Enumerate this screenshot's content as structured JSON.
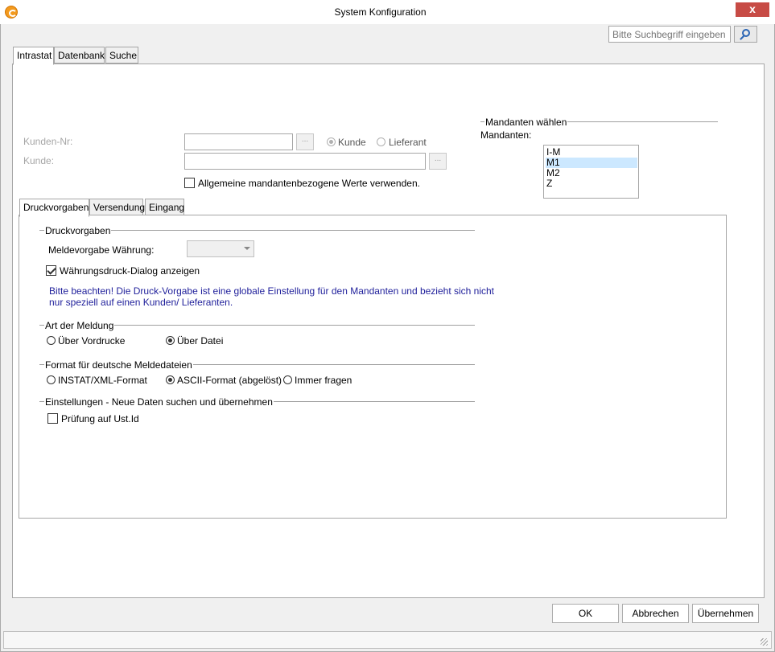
{
  "window": {
    "title": "System Konfiguration",
    "close_label": "x"
  },
  "search": {
    "placeholder": "Bitte Suchbegriff eingeben"
  },
  "main_tabs": [
    "Intrastat",
    "Datenbank",
    "Suche"
  ],
  "customer": {
    "kunden_nr_label": "Kunden-Nr:",
    "kunde_label": "Kunde:",
    "browse_label": "...",
    "radio_kunde": "Kunde",
    "radio_lieferant": "Lieferant",
    "general_values_label": "Allgemeine mandantenbezogene Werte verwenden."
  },
  "mandanten": {
    "group_title": "Mandanten wählen",
    "label": "Mandanten:",
    "items": [
      "I-M",
      "M1",
      "M2",
      "Z"
    ],
    "selected": "M1"
  },
  "sub_tabs": [
    "Druckvorgaben",
    "Versendung",
    "Eingang"
  ],
  "druckvorgaben": {
    "group_title": "Druckvorgaben",
    "meldevorgabe_label": "Meldevorgabe Währung:",
    "currency_dialog_label": "Währungsdruck-Dialog anzeigen",
    "note_line1": "Bitte beachten! Die Druck-Vorgabe ist eine globale Einstellung für den Mandanten und bezieht sich nicht",
    "note_line2": "nur speziell auf einen Kunden/ Lieferanten."
  },
  "art_der_meldung": {
    "group_title": "Art der Meldung",
    "option1": "Über Vordrucke",
    "option2": "Über Datei"
  },
  "format": {
    "group_title": "Format für deutsche Meldedateien",
    "option1": "INSTAT/XML-Format",
    "option2": "ASCII-Format (abgelöst)",
    "option3": "Immer fragen"
  },
  "einstellungen": {
    "group_title": "Einstellungen - Neue Daten suchen und übernehmen",
    "ustid_label": "Prüfung auf Ust.Id"
  },
  "buttons": {
    "ok": "OK",
    "cancel": "Abbrechen",
    "apply": "Übernehmen"
  }
}
